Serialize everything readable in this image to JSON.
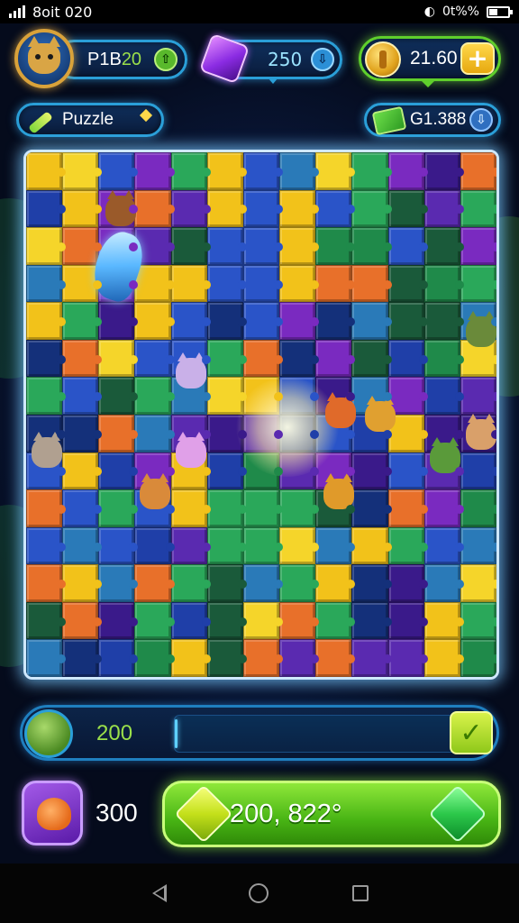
{
  "status_bar": {
    "time": "8oit 020",
    "battery_text": "0t%%"
  },
  "hud": {
    "player_label": "P1B",
    "player_value": "20",
    "gems": "250",
    "coins": "21.60",
    "mode_label": "Puzzle",
    "cash": "G1.388"
  },
  "progress": {
    "value_label": "200",
    "fill_fraction": 0.01
  },
  "bottom": {
    "count": "300",
    "action_label": "200, 822°"
  },
  "colors": {
    "accent_blue": "#2a9fd8",
    "accent_green": "#5fcf2c",
    "board_glow": "#cfe8ff"
  },
  "icons": [
    "signal-icon",
    "wifi-icon",
    "battery-icon",
    "avatar-cat-icon",
    "gem-icon",
    "coin-icon",
    "plus-icon",
    "wand-icon",
    "cash-icon",
    "check-icon",
    "fox-icon",
    "diamond-icon",
    "back-icon",
    "home-icon",
    "recent-apps-icon"
  ]
}
